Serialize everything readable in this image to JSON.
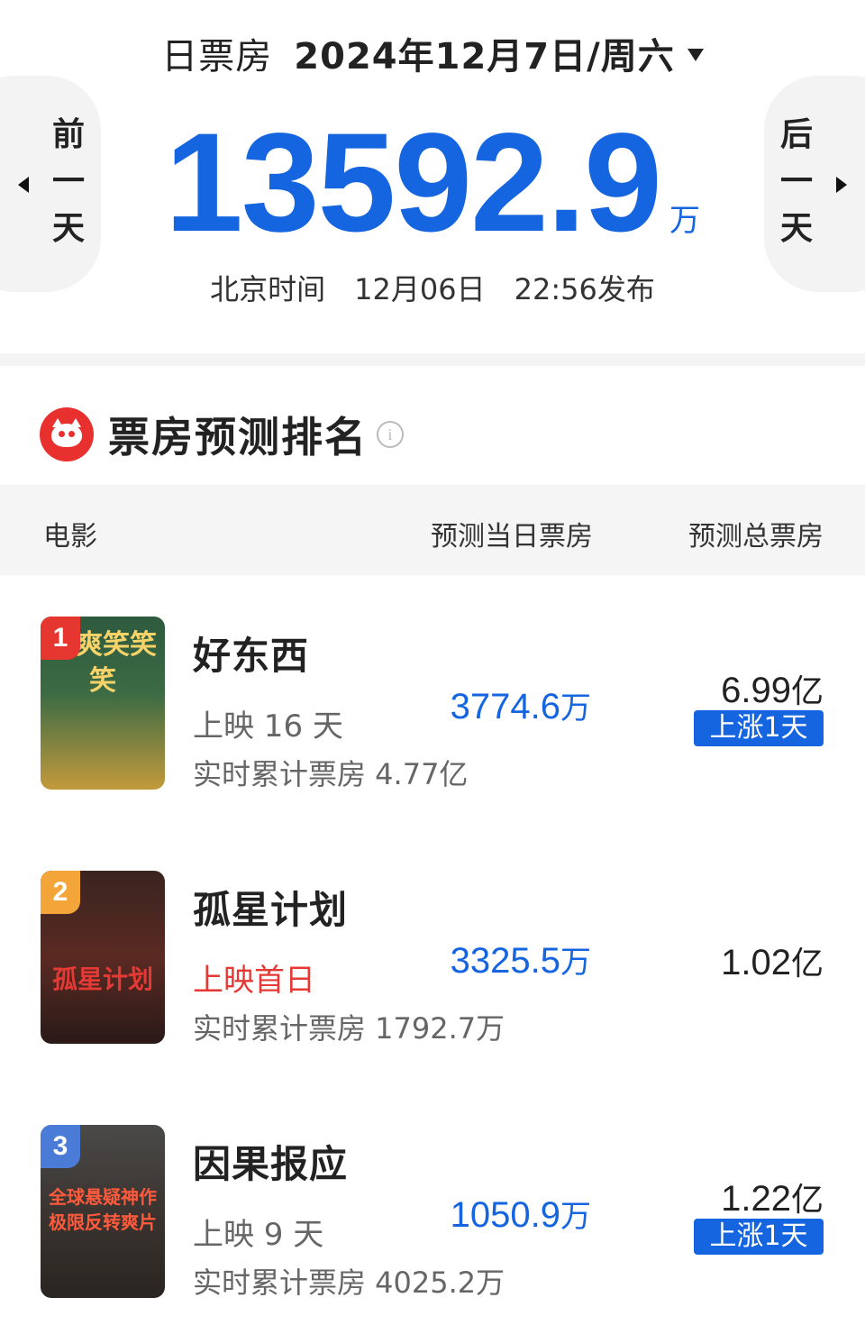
{
  "header": {
    "label": "日票房",
    "date": "2024年12月7日/周六",
    "prev_day": "前一天",
    "next_day": "后一天",
    "total_value": "13592.9",
    "total_unit": "万",
    "publish_info": "北京时间　12月06日　22:56发布"
  },
  "section": {
    "title": "票房预测排名",
    "info_symbol": "i",
    "col_movie": "电影",
    "col_day_pred": "预测当日票房",
    "col_total_pred": "预测总票房"
  },
  "movies": [
    {
      "rank": "1",
      "poster_text": "爽爽笑笑笑",
      "name": "好东西",
      "days": "上映 16 天",
      "cumulative": "实时累计票房 4.77亿",
      "day_pred": "3774.6",
      "day_unit": "万",
      "total_pred": "6.99",
      "total_unit": "亿",
      "trend": "上涨1天"
    },
    {
      "rank": "2",
      "poster_text": "孤星计划",
      "name": "孤星计划",
      "days": "上映首日",
      "cumulative": "实时累计票房 1792.7万",
      "day_pred": "3325.5",
      "day_unit": "万",
      "total_pred": "1.02",
      "total_unit": "亿",
      "trend": ""
    },
    {
      "rank": "3",
      "poster_text": "全球悬疑神作 极限反转爽片",
      "name": "因果报应",
      "days": "上映 9 天",
      "cumulative": "实时累计票房 4025.2万",
      "day_pred": "1050.9",
      "day_unit": "万",
      "total_pred": "1.22",
      "total_unit": "亿",
      "trend": "上涨1天"
    }
  ],
  "colors": {
    "accent_blue": "#1565e0",
    "highlight_red": "#e53935",
    "brand_red": "#e8312f"
  }
}
